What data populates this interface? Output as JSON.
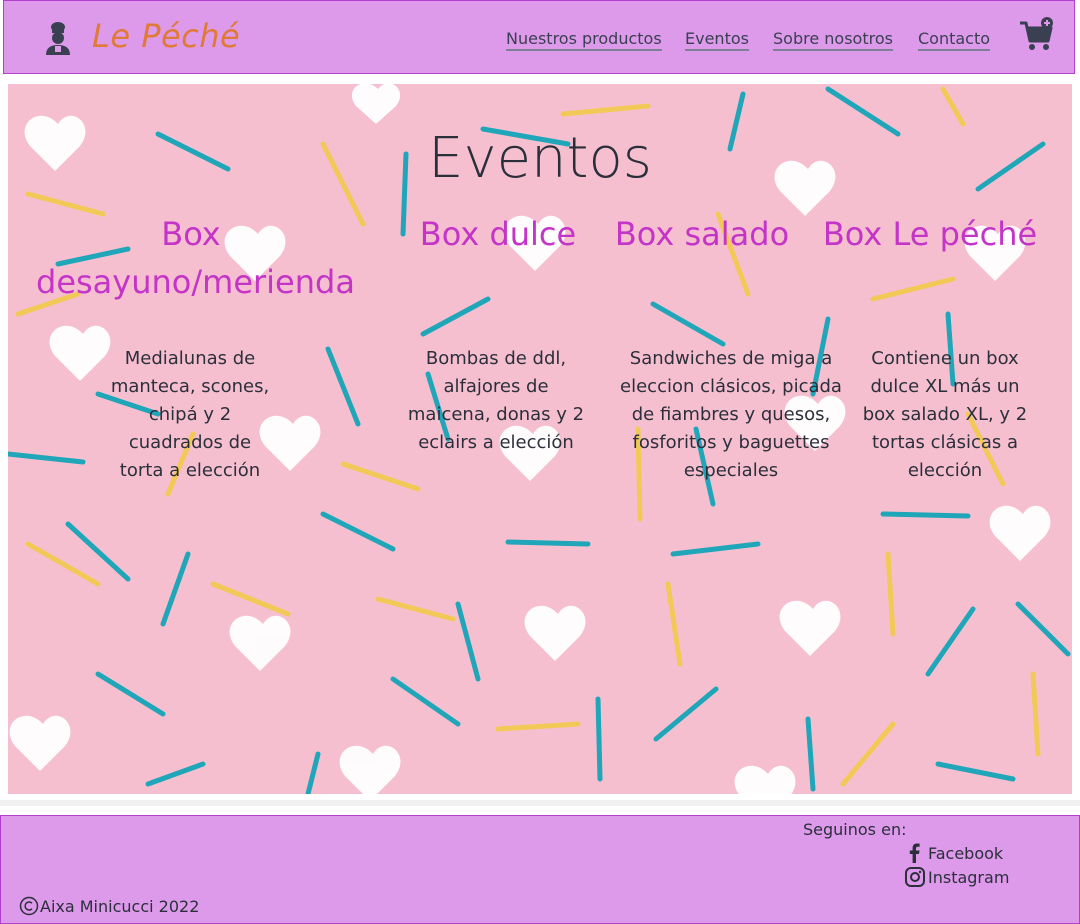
{
  "header": {
    "brand": "Le Péché",
    "nav": [
      "Nuestros productos",
      "Eventos",
      "Sobre nosotros",
      "Contacto"
    ],
    "logo_icon": "chef-icon",
    "cart_icon": "cart-plus-icon"
  },
  "hero": {
    "title": "Eventos",
    "boxes": [
      {
        "title": "Box desayuno/merienda",
        "description": "Medialunas de manteca, scones, chipá y 2 cuadrados de torta a elección"
      },
      {
        "title": "Box dulce",
        "description": "Bombas de ddl, alfajores de maicena, donas y 2 eclairs a elección"
      },
      {
        "title": "Box salado",
        "description": "Sandwiches de miga a eleccion clásicos, picada de fiambres y quesos, fosforitos y baguettes especiales"
      },
      {
        "title": "Box Le péché",
        "description": "Contiene un box dulce XL más un box salado XL, y 2 tortas clásicas a elección"
      }
    ]
  },
  "footer": {
    "follow_label": "Seguinos en:",
    "facebook": "Facebook",
    "instagram": "Instagram",
    "copyright": "Aixa Minicucci 2022"
  },
  "colors": {
    "header_bg": "#dd99ea",
    "brand": "#e07a37",
    "box_title": "#c334c7",
    "hero_bg": "#f6bfd0"
  }
}
